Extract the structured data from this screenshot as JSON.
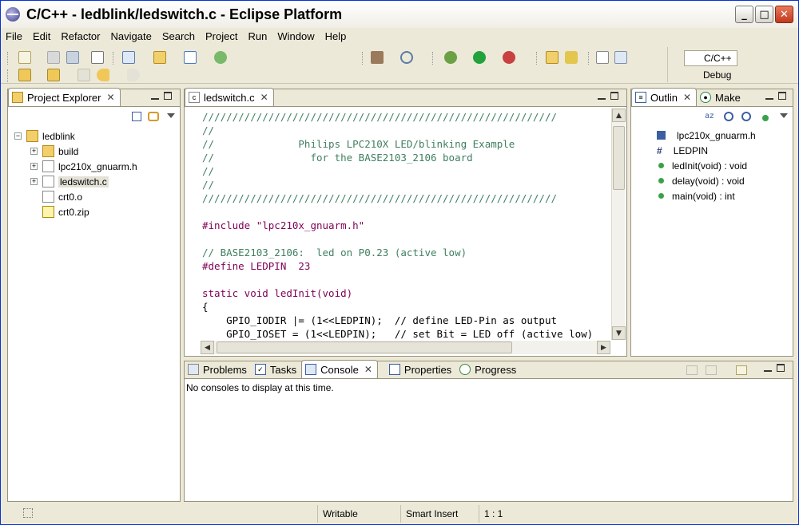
{
  "window": {
    "title": "C/C++ - ledblink/ledswitch.c - Eclipse Platform"
  },
  "menu": [
    "File",
    "Edit",
    "Refactor",
    "Navigate",
    "Search",
    "Project",
    "Run",
    "Window",
    "Help"
  ],
  "perspectives": {
    "cpp": "C/C++",
    "debug": "Debug"
  },
  "project_explorer": {
    "tab_label": "Project Explorer",
    "items": [
      {
        "label": "ledblink",
        "icon": "project-icon"
      },
      {
        "label": "build",
        "icon": "folder-icon"
      },
      {
        "label": "lpc210x_gnuarm.h",
        "icon": "header-file-icon"
      },
      {
        "label": "ledswitch.c",
        "icon": "c-file-icon"
      },
      {
        "label": "crt0.o",
        "icon": "object-file-icon"
      },
      {
        "label": "crt0.zip",
        "icon": "zip-file-icon"
      }
    ]
  },
  "editor": {
    "tab_label": "ledswitch.c",
    "lines": [
      "///////////////////////////////////////////////////////////",
      "//",
      "//              Philips LPC210X LED/blinking Example",
      "//                for the BASE2103_2106 board",
      "//",
      "//",
      "///////////////////////////////////////////////////////////",
      "",
      "#include \"lpc210x_gnuarm.h\"",
      "",
      "// BASE2103_2106:  led on P0.23 (active low)",
      "#define LEDPIN  23",
      "",
      "static void ledInit(void)",
      "{",
      "    GPIO_IODIR |= (1<<LEDPIN);  // define LED-Pin as output",
      "    GPIO_IOSET = (1<<LEDPIN);   // set Bit = LED off (active low)"
    ]
  },
  "outline": {
    "tab_outline": "Outlin",
    "tab_make": "Make",
    "items": [
      {
        "label": "lpc210x_gnuarm.h",
        "icon": "include-icon"
      },
      {
        "label": "LEDPIN",
        "icon": "macro-icon"
      },
      {
        "label": "ledInit(void) : void",
        "icon": "static-function-icon"
      },
      {
        "label": "delay(void) : void",
        "icon": "static-function-icon"
      },
      {
        "label": "main(void) : int",
        "icon": "function-icon"
      }
    ]
  },
  "bottom": {
    "tabs": [
      "Problems",
      "Tasks",
      "Console",
      "Properties",
      "Progress"
    ],
    "active_tab": "Console",
    "message": "No consoles to display at this time."
  },
  "status": {
    "writable": "Writable",
    "insert_mode": "Smart Insert",
    "position": "1 : 1"
  }
}
